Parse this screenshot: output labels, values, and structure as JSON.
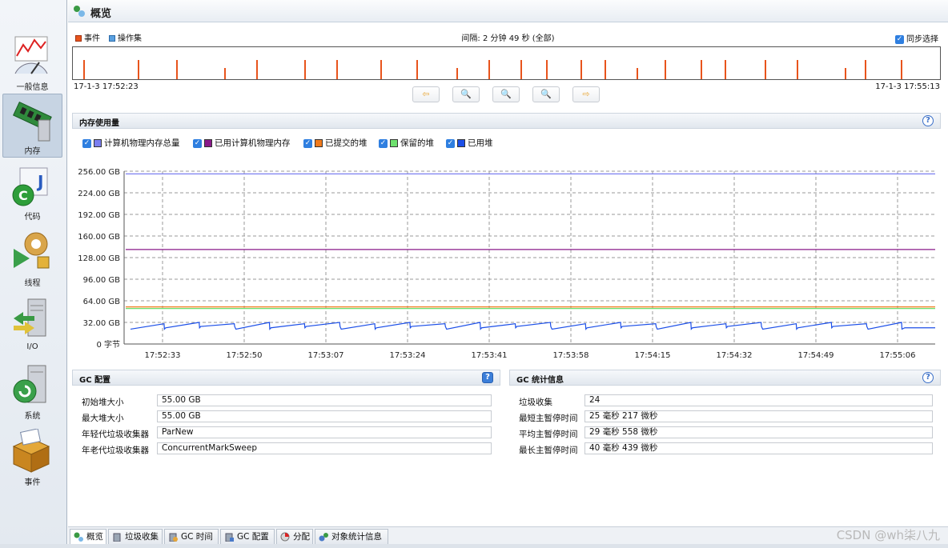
{
  "sidebar": {
    "items": [
      {
        "label": "一般信息",
        "icon": "overview-gauge-icon"
      },
      {
        "label": "内存",
        "icon": "memory-chip-icon",
        "active": true
      },
      {
        "label": "代码",
        "icon": "code-java-icon"
      },
      {
        "label": "线程",
        "icon": "thread-gear-icon"
      },
      {
        "label": "I/O",
        "icon": "io-server-icon"
      },
      {
        "label": "系统",
        "icon": "system-server-icon"
      },
      {
        "label": "事件",
        "icon": "events-box-icon"
      }
    ]
  },
  "header": {
    "title": "概览"
  },
  "timeline": {
    "legend_events": "事件",
    "legend_ops": "操作集",
    "interval": "间隔: 2 分钟 49 秒 (全部)",
    "sync_label": "同步选择",
    "start": "17-1-3 17:52:23",
    "end": "17-1-3 17:55:13",
    "event_color": "#e8541c",
    "ops_color": "#5aa0e0"
  },
  "memory": {
    "title": "内存使用量",
    "help": "?",
    "legend": [
      {
        "label": "计算机物理内存总量",
        "color": "#7b7ff0"
      },
      {
        "label": "已用计算机物理内存",
        "color": "#8a1a8a"
      },
      {
        "label": "已提交的堆",
        "color": "#f07a1c"
      },
      {
        "label": "保留的堆",
        "color": "#6ee06e"
      },
      {
        "label": "已用堆",
        "color": "#1c4fe8"
      }
    ]
  },
  "chart_data": {
    "type": "line",
    "x": [
      "17:52:33",
      "17:52:50",
      "17:53:07",
      "17:53:24",
      "17:53:41",
      "17:53:58",
      "17:54:15",
      "17:54:32",
      "17:54:49",
      "17:55:06"
    ],
    "yticks": [
      "256.00 GB",
      "224.00 GB",
      "192.00 GB",
      "160.00 GB",
      "128.00 GB",
      "96.00 GB",
      "64.00 GB",
      "32.00 GB",
      "0 字节"
    ],
    "ylim": [
      0,
      256
    ],
    "series": [
      {
        "name": "计算机物理内存总量",
        "values": [
          252,
          252,
          252,
          252,
          252,
          252,
          252,
          252,
          252,
          252
        ]
      },
      {
        "name": "已用计算机物理内存",
        "values": [
          140,
          140,
          140,
          140,
          140,
          140,
          140,
          140,
          140,
          140
        ]
      },
      {
        "name": "已提交的堆",
        "values": [
          55,
          55,
          55,
          55,
          55,
          55,
          55,
          55,
          55,
          55
        ]
      },
      {
        "name": "保留的堆",
        "values": [
          55,
          55,
          55,
          55,
          55,
          55,
          55,
          55,
          55,
          55
        ]
      },
      {
        "name": "已用堆",
        "values": [
          25,
          29,
          24,
          31,
          22,
          32,
          26,
          30,
          24,
          30
        ]
      }
    ],
    "grid": true
  },
  "gc_config": {
    "title": "GC 配置",
    "help": "?",
    "rows": [
      {
        "label": "初始堆大小",
        "value": "55.00 GB"
      },
      {
        "label": "最大堆大小",
        "value": "55.00 GB"
      },
      {
        "label": "年轻代垃圾收集器",
        "value": "ParNew"
      },
      {
        "label": "年老代垃圾收集器",
        "value": "ConcurrentMarkSweep"
      }
    ]
  },
  "gc_stats": {
    "title": "GC 统计信息",
    "help": "?",
    "rows": [
      {
        "label": "垃圾收集",
        "value": "24"
      },
      {
        "label": "最短主暂停时间",
        "value": "25 毫秒 217 微秒"
      },
      {
        "label": "平均主暂停时间",
        "value": "29 毫秒 558 微秒"
      },
      {
        "label": "最长主暂停时间",
        "value": "40 毫秒 439 微秒"
      }
    ]
  },
  "tabs": [
    {
      "label": "概览",
      "icon": "overview-icon",
      "active": true
    },
    {
      "label": "垃圾收集",
      "icon": "trash-icon"
    },
    {
      "label": "GC 时间",
      "icon": "gc-time-icon"
    },
    {
      "label": "GC 配置",
      "icon": "gc-config-icon"
    },
    {
      "label": "分配",
      "icon": "allocation-icon"
    },
    {
      "label": "对象统计信息",
      "icon": "object-stats-icon"
    }
  ],
  "watermark": "CSDN @wh柒八九"
}
